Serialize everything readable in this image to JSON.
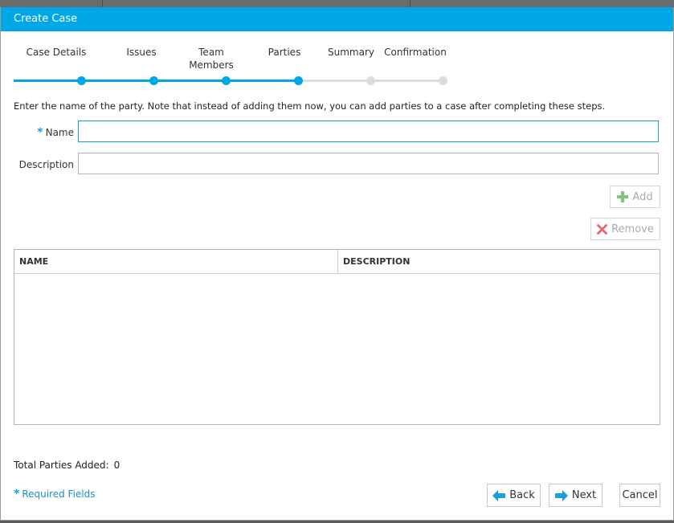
{
  "dialog": {
    "title": "Create Case"
  },
  "stepper": {
    "steps": [
      {
        "label": "Case Details",
        "state": "done"
      },
      {
        "label": "Issues",
        "state": "done"
      },
      {
        "label": "Team Members",
        "state": "done"
      },
      {
        "label": "Parties",
        "state": "current"
      },
      {
        "label": "Summary",
        "state": "todo"
      },
      {
        "label": "Confirmation",
        "state": "todo"
      }
    ]
  },
  "instructions": "Enter the name of the party. Note that instead of adding them now, you can add parties to a case after completing these steps.",
  "form": {
    "name_label": "Name",
    "name_required_marker": "*",
    "name_value": "",
    "description_label": "Description",
    "description_value": ""
  },
  "actions": {
    "add_label": "Add",
    "remove_label": "Remove"
  },
  "grid": {
    "columns": [
      "NAME",
      "DESCRIPTION"
    ],
    "rows": []
  },
  "summary": {
    "total_label": "Total Parties Added:",
    "total_count": "0"
  },
  "footer": {
    "required_marker": "*",
    "required_label": "Required Fields",
    "back_label": "Back",
    "next_label": "Next",
    "cancel_label": "Cancel"
  },
  "colors": {
    "accent": "#00a7e7",
    "add_icon": "#7dc47d",
    "remove_icon": "#e06b6b"
  }
}
